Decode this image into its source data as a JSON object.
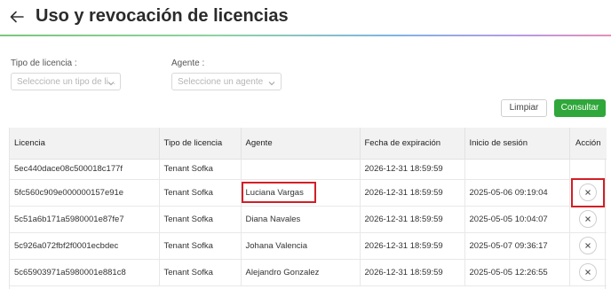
{
  "header": {
    "title": "Uso y revocación de licencias",
    "back_icon": "arrow-left-icon"
  },
  "filters": {
    "license_type": {
      "label": "Tipo de licencia :",
      "placeholder": "Seleccione un tipo de li..."
    },
    "agent": {
      "label": "Agente :",
      "placeholder": "Seleccione un agente"
    }
  },
  "actions": {
    "clear_label": "Limpiar",
    "query_label": "Consultar",
    "query_color": "#2fa73a"
  },
  "table": {
    "columns": [
      "Licencia",
      "Tipo de licencia",
      "Agente",
      "Fecha de expiración",
      "Inicio de sesión",
      "Acción"
    ],
    "rows": [
      {
        "license": "5ec440dace08c500018c177f",
        "type": "Tenant Sofka",
        "agent": "",
        "expires": "2026-12-31 18:59:59",
        "session": "",
        "revoke": false
      },
      {
        "license": "5fc560c909e000000157e91e",
        "type": "Tenant Sofka",
        "agent": "Luciana Vargas",
        "expires": "2026-12-31 18:59:59",
        "session": "2025-05-06 09:19:04",
        "revoke": true
      },
      {
        "license": "5c51a6b171a5980001e87fe7",
        "type": "Tenant Sofka",
        "agent": "Diana Navales",
        "expires": "2026-12-31 18:59:59",
        "session": "2025-05-05 10:04:07",
        "revoke": true
      },
      {
        "license": "5c926a072fbf2f0001ecbdec",
        "type": "Tenant Sofka",
        "agent": "Johana Valencia",
        "expires": "2026-12-31 18:59:59",
        "session": "2025-05-07 09:36:17",
        "revoke": true
      },
      {
        "license": "5c65903971a5980001e881c8",
        "type": "Tenant Sofka",
        "agent": "Alejandro Gonzalez",
        "expires": "2026-12-31 18:59:59",
        "session": "2025-05-05 12:26:55",
        "revoke": true
      }
    ]
  },
  "highlight_color": "#d21f26"
}
